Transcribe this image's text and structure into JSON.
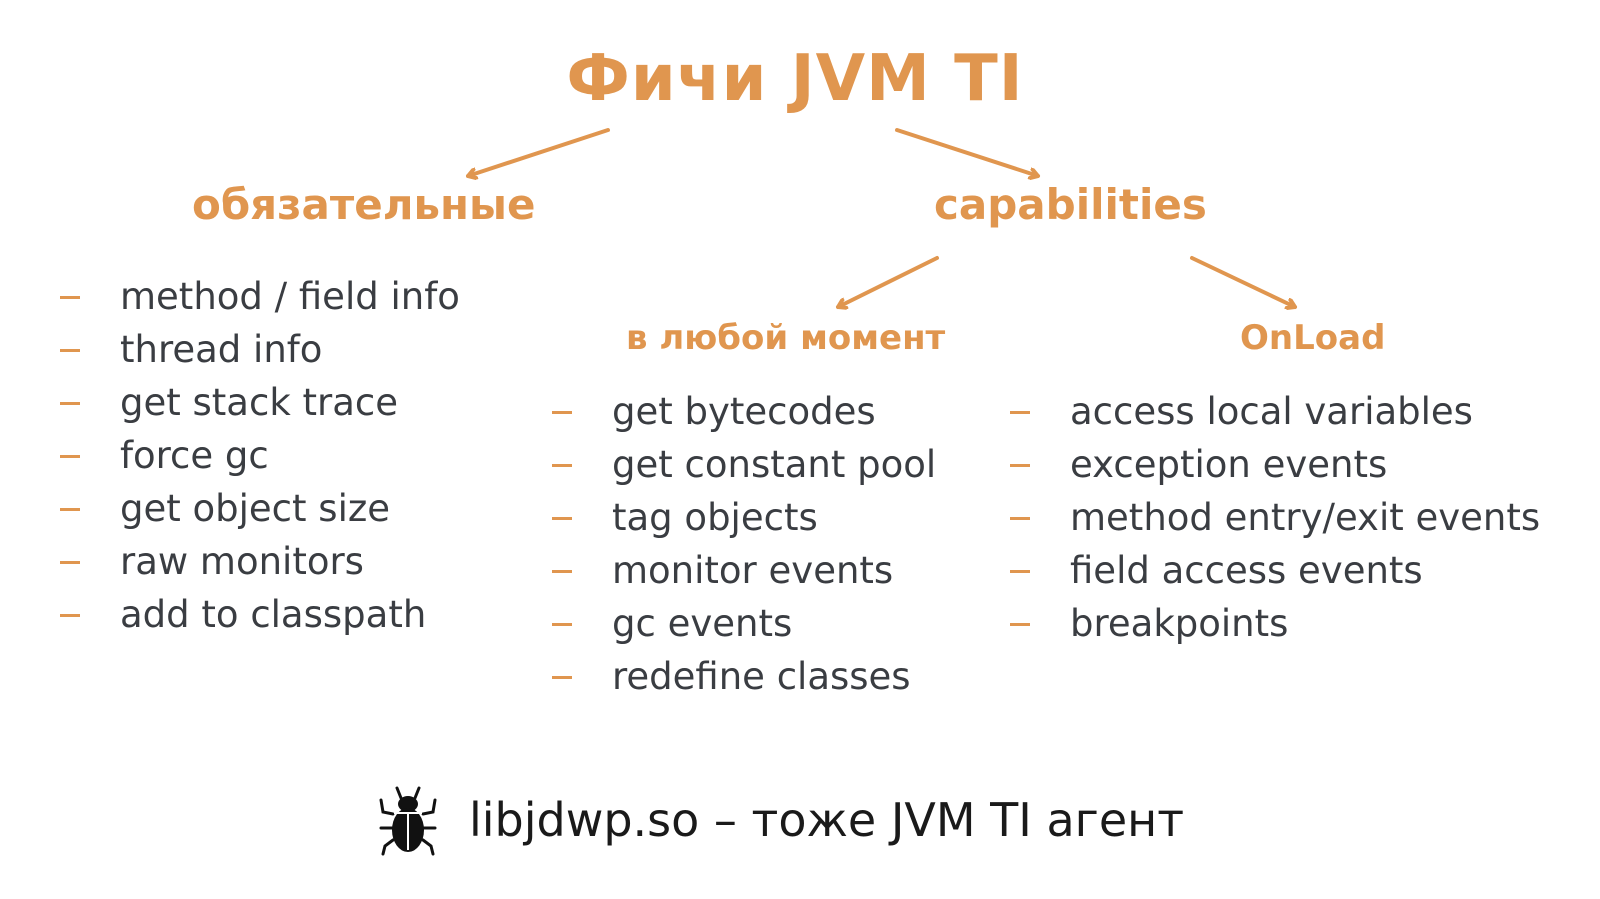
{
  "title": "Фичи JVM TI",
  "colors": {
    "accent": "#e0964f",
    "text": "#3a3d42",
    "footer_text": "#1a1a1a"
  },
  "required": {
    "heading": "обязательные",
    "items": [
      "method / field info",
      "thread info",
      "get stack trace",
      "force gc",
      "get object size",
      "raw monitors",
      "add to classpath"
    ]
  },
  "capabilities": {
    "heading": "capabilities",
    "any_time": {
      "heading": "в любой момент",
      "items": [
        "get bytecodes",
        "get constant pool",
        "tag objects",
        "monitor events",
        "gc events",
        "redefine classes"
      ]
    },
    "onload": {
      "heading": "OnLoad",
      "items": [
        "access local variables",
        "exception events",
        "method entry/exit events",
        "field access events",
        "breakpoints"
      ]
    }
  },
  "footer": {
    "icon": "bug-icon",
    "text": "libjdwp.so – тоже JVM TI агент"
  }
}
